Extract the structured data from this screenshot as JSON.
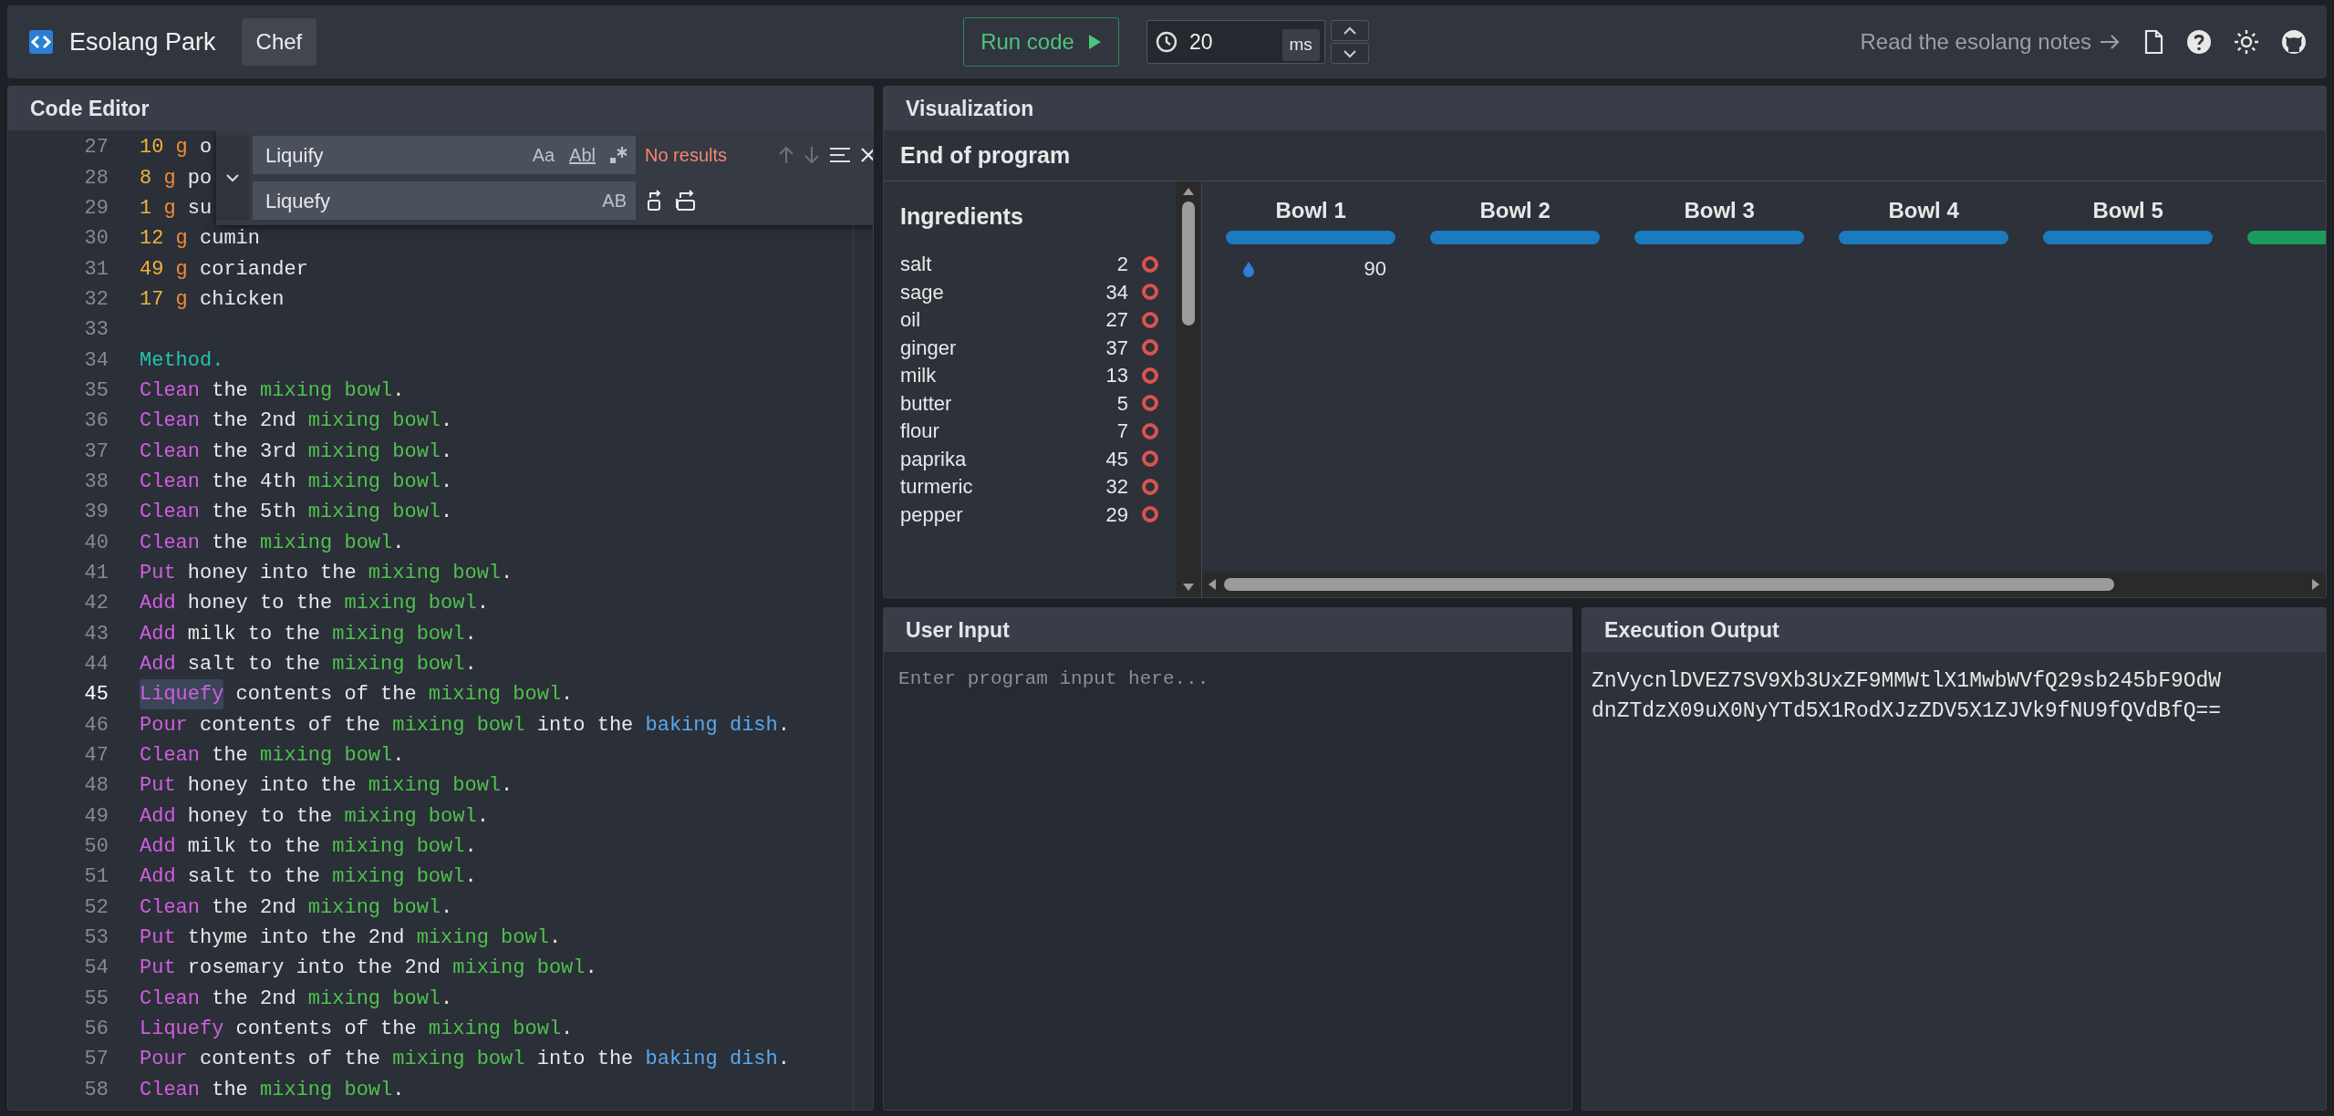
{
  "app": {
    "title": "Esolang Park",
    "language": "Chef"
  },
  "toolbar": {
    "run_label": "Run code",
    "interval": "20",
    "interval_unit": "ms",
    "notes_link": "Read the esolang notes"
  },
  "editor": {
    "title": "Code Editor",
    "lines": [
      {
        "number": "27",
        "current": false,
        "tokens": [
          {
            "kind": "qty",
            "text": "10"
          },
          {
            "kind": "unit",
            "text": " g"
          },
          {
            "kind": "plain",
            "text": " o"
          }
        ]
      },
      {
        "number": "28",
        "current": false,
        "tokens": [
          {
            "kind": "qty",
            "text": "8"
          },
          {
            "kind": "unit",
            "text": " g"
          },
          {
            "kind": "plain",
            "text": " po"
          }
        ]
      },
      {
        "number": "29",
        "current": false,
        "tokens": [
          {
            "kind": "qty",
            "text": "1"
          },
          {
            "kind": "unit",
            "text": " g"
          },
          {
            "kind": "plain",
            "text": " su"
          }
        ]
      },
      {
        "number": "30",
        "current": false,
        "tokens": [
          {
            "kind": "qty",
            "text": "12"
          },
          {
            "kind": "unit",
            "text": " g"
          },
          {
            "kind": "plain",
            "text": " cumin"
          }
        ]
      },
      {
        "number": "31",
        "current": false,
        "tokens": [
          {
            "kind": "qty",
            "text": "49"
          },
          {
            "kind": "unit",
            "text": " g"
          },
          {
            "kind": "plain",
            "text": " coriander"
          }
        ]
      },
      {
        "number": "32",
        "current": false,
        "tokens": [
          {
            "kind": "qty",
            "text": "17"
          },
          {
            "kind": "unit",
            "text": " g"
          },
          {
            "kind": "plain",
            "text": " chicken"
          }
        ]
      },
      {
        "number": "33",
        "current": false
      },
      {
        "number": "34",
        "current": false,
        "tokens": [
          {
            "kind": "heading",
            "text": "Method."
          }
        ]
      },
      {
        "number": "35",
        "current": false,
        "tokens": [
          {
            "kind": "keyword",
            "text": "Clean"
          },
          {
            "kind": "plain",
            "text": " the "
          },
          {
            "kind": "bowl",
            "text": "mixing bowl"
          },
          {
            "kind": "plain",
            "text": "."
          }
        ]
      },
      {
        "number": "36",
        "current": false,
        "tokens": [
          {
            "kind": "keyword",
            "text": "Clean"
          },
          {
            "kind": "plain",
            "text": " the 2nd "
          },
          {
            "kind": "bowl",
            "text": "mixing bowl"
          },
          {
            "kind": "plain",
            "text": "."
          }
        ]
      },
      {
        "number": "37",
        "current": false,
        "tokens": [
          {
            "kind": "keyword",
            "text": "Clean"
          },
          {
            "kind": "plain",
            "text": " the 3rd "
          },
          {
            "kind": "bowl",
            "text": "mixing bowl"
          },
          {
            "kind": "plain",
            "text": "."
          }
        ]
      },
      {
        "number": "38",
        "current": false,
        "tokens": [
          {
            "kind": "keyword",
            "text": "Clean"
          },
          {
            "kind": "plain",
            "text": " the 4th "
          },
          {
            "kind": "bowl",
            "text": "mixing bowl"
          },
          {
            "kind": "plain",
            "text": "."
          }
        ]
      },
      {
        "number": "39",
        "current": false,
        "tokens": [
          {
            "kind": "keyword",
            "text": "Clean"
          },
          {
            "kind": "plain",
            "text": " the 5th "
          },
          {
            "kind": "bowl",
            "text": "mixing bowl"
          },
          {
            "kind": "plain",
            "text": "."
          }
        ]
      },
      {
        "number": "40",
        "current": false,
        "tokens": [
          {
            "kind": "keyword",
            "text": "Clean"
          },
          {
            "kind": "plain",
            "text": " the "
          },
          {
            "kind": "bowl",
            "text": "mixing bowl"
          },
          {
            "kind": "plain",
            "text": "."
          }
        ]
      },
      {
        "number": "41",
        "current": false,
        "tokens": [
          {
            "kind": "keyword",
            "text": "Put"
          },
          {
            "kind": "plain",
            "text": " honey into the "
          },
          {
            "kind": "bowl",
            "text": "mixing bowl"
          },
          {
            "kind": "plain",
            "text": "."
          }
        ]
      },
      {
        "number": "42",
        "current": false,
        "tokens": [
          {
            "kind": "keyword",
            "text": "Add"
          },
          {
            "kind": "plain",
            "text": " honey to the "
          },
          {
            "kind": "bowl",
            "text": "mixing bowl"
          },
          {
            "kind": "plain",
            "text": "."
          }
        ]
      },
      {
        "number": "43",
        "current": false,
        "tokens": [
          {
            "kind": "keyword",
            "text": "Add"
          },
          {
            "kind": "plain",
            "text": " milk to the "
          },
          {
            "kind": "bowl",
            "text": "mixing bowl"
          },
          {
            "kind": "plain",
            "text": "."
          }
        ]
      },
      {
        "number": "44",
        "current": false,
        "tokens": [
          {
            "kind": "keyword",
            "text": "Add"
          },
          {
            "kind": "plain",
            "text": " salt to the "
          },
          {
            "kind": "bowl",
            "text": "mixing bowl"
          },
          {
            "kind": "plain",
            "text": "."
          }
        ]
      },
      {
        "number": "45",
        "current": true,
        "tokens": [
          {
            "kind": "match",
            "text": "Liquefy"
          },
          {
            "kind": "plain",
            "text": " contents of the "
          },
          {
            "kind": "bowl",
            "text": "mixing bowl"
          },
          {
            "kind": "plain",
            "text": "."
          }
        ]
      },
      {
        "number": "46",
        "current": false,
        "tokens": [
          {
            "kind": "keyword",
            "text": "Pour"
          },
          {
            "kind": "plain",
            "text": " contents of the "
          },
          {
            "kind": "bowl",
            "text": "mixing bowl"
          },
          {
            "kind": "plain",
            "text": " into the "
          },
          {
            "kind": "dish",
            "text": "baking dish"
          },
          {
            "kind": "plain",
            "text": "."
          }
        ]
      },
      {
        "number": "47",
        "current": false,
        "tokens": [
          {
            "kind": "keyword",
            "text": "Clean"
          },
          {
            "kind": "plain",
            "text": " the "
          },
          {
            "kind": "bowl",
            "text": "mixing bowl"
          },
          {
            "kind": "plain",
            "text": "."
          }
        ]
      },
      {
        "number": "48",
        "current": false,
        "tokens": [
          {
            "kind": "keyword",
            "text": "Put"
          },
          {
            "kind": "plain",
            "text": " honey into the "
          },
          {
            "kind": "bowl",
            "text": "mixing bowl"
          },
          {
            "kind": "plain",
            "text": "."
          }
        ]
      },
      {
        "number": "49",
        "current": false,
        "tokens": [
          {
            "kind": "keyword",
            "text": "Add"
          },
          {
            "kind": "plain",
            "text": " honey to the "
          },
          {
            "kind": "bowl",
            "text": "mixing bowl"
          },
          {
            "kind": "plain",
            "text": "."
          }
        ]
      },
      {
        "number": "50",
        "current": false,
        "tokens": [
          {
            "kind": "keyword",
            "text": "Add"
          },
          {
            "kind": "plain",
            "text": " milk to the "
          },
          {
            "kind": "bowl",
            "text": "mixing bowl"
          },
          {
            "kind": "plain",
            "text": "."
          }
        ]
      },
      {
        "number": "51",
        "current": false,
        "tokens": [
          {
            "kind": "keyword",
            "text": "Add"
          },
          {
            "kind": "plain",
            "text": " salt to the "
          },
          {
            "kind": "bowl",
            "text": "mixing bowl"
          },
          {
            "kind": "plain",
            "text": "."
          }
        ]
      },
      {
        "number": "52",
        "current": false,
        "tokens": [
          {
            "kind": "keyword",
            "text": "Clean"
          },
          {
            "kind": "plain",
            "text": " the 2nd "
          },
          {
            "kind": "bowl",
            "text": "mixing bowl"
          },
          {
            "kind": "plain",
            "text": "."
          }
        ]
      },
      {
        "number": "53",
        "current": false,
        "tokens": [
          {
            "kind": "keyword",
            "text": "Put"
          },
          {
            "kind": "plain",
            "text": " thyme into the 2nd "
          },
          {
            "kind": "bowl",
            "text": "mixing bowl"
          },
          {
            "kind": "plain",
            "text": "."
          }
        ]
      },
      {
        "number": "54",
        "current": false,
        "tokens": [
          {
            "kind": "keyword",
            "text": "Put"
          },
          {
            "kind": "plain",
            "text": " rosemary into the 2nd "
          },
          {
            "kind": "bowl",
            "text": "mixing bowl"
          },
          {
            "kind": "plain",
            "text": "."
          }
        ]
      },
      {
        "number": "55",
        "current": false,
        "tokens": [
          {
            "kind": "keyword",
            "text": "Clean"
          },
          {
            "kind": "plain",
            "text": " the 2nd "
          },
          {
            "kind": "bowl",
            "text": "mixing bowl"
          },
          {
            "kind": "plain",
            "text": "."
          }
        ]
      },
      {
        "number": "56",
        "current": false,
        "tokens": [
          {
            "kind": "keyword",
            "text": "Liquefy"
          },
          {
            "kind": "plain",
            "text": " contents of the "
          },
          {
            "kind": "bowl",
            "text": "mixing bowl"
          },
          {
            "kind": "plain",
            "text": "."
          }
        ]
      },
      {
        "number": "57",
        "current": false,
        "tokens": [
          {
            "kind": "keyword",
            "text": "Pour"
          },
          {
            "kind": "plain",
            "text": " contents of the "
          },
          {
            "kind": "bowl",
            "text": "mixing bowl"
          },
          {
            "kind": "plain",
            "text": " into the "
          },
          {
            "kind": "dish",
            "text": "baking dish"
          },
          {
            "kind": "plain",
            "text": "."
          }
        ]
      },
      {
        "number": "58",
        "current": false,
        "tokens": [
          {
            "kind": "keyword",
            "text": "Clean"
          },
          {
            "kind": "plain",
            "text": " the "
          },
          {
            "kind": "bowl",
            "text": "mixing bowl"
          },
          {
            "kind": "plain",
            "text": "."
          }
        ]
      }
    ],
    "find": {
      "expanded": true,
      "query": "Liquify",
      "match_case": "Aa",
      "whole_word": "Abl",
      "status": "No results",
      "replace": "Liquefy",
      "preserve_case": "AB"
    }
  },
  "visualization": {
    "title": "Visualization",
    "status": "End of program",
    "ingredients_title": "Ingredients",
    "ingredients": [
      {
        "name": "salt",
        "amount": "2"
      },
      {
        "name": "sage",
        "amount": "34"
      },
      {
        "name": "oil",
        "amount": "27"
      },
      {
        "name": "ginger",
        "amount": "37"
      },
      {
        "name": "milk",
        "amount": "13"
      },
      {
        "name": "butter",
        "amount": "5"
      },
      {
        "name": "flour",
        "amount": "7"
      },
      {
        "name": "paprika",
        "amount": "45"
      },
      {
        "name": "turmeric",
        "amount": "32"
      },
      {
        "name": "pepper",
        "amount": "29"
      }
    ],
    "bowls": [
      {
        "label": "Bowl 1",
        "color": "#1a7bbf",
        "contents": [
          {
            "kind": "liquid",
            "value": "90"
          }
        ]
      },
      {
        "label": "Bowl 2",
        "color": "#1a7bbf"
      },
      {
        "label": "Bowl 3",
        "color": "#1a7bbf"
      },
      {
        "label": "Bowl 4",
        "color": "#1a7bbf"
      },
      {
        "label": "Bowl 5",
        "color": "#1a7bbf"
      },
      {
        "color": "#1a9a5c"
      }
    ]
  },
  "input": {
    "title": "User Input",
    "placeholder": "Enter program input here..."
  },
  "output": {
    "title": "Execution Output",
    "text": "ZnVycnlDVEZ7SV9Xb3UxZF9MMWtlX1MwbWVfQ29sb245bF9OdWdnZTdzX09uX0NyYTd5X1RodXJzZDV5X1ZJVk9fNU9fQVdBfQ=="
  }
}
